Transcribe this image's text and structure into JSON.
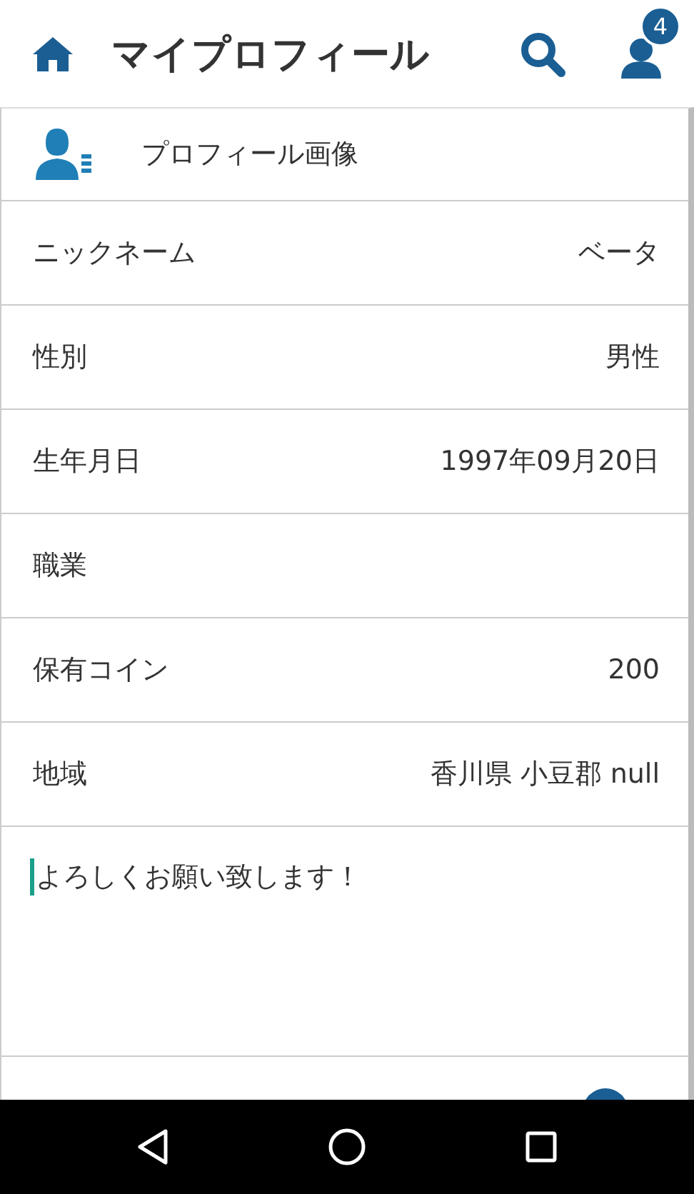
{
  "header": {
    "title": "マイプロフィール",
    "badge": "4"
  },
  "profile_image": {
    "label": "プロフィール画像"
  },
  "fields": [
    {
      "label": "ニックネーム",
      "value": "ベータ"
    },
    {
      "label": "性別",
      "value": "男性"
    },
    {
      "label": "生年月日",
      "value": "1997年09月20日"
    },
    {
      "label": "職業"
    },
    {
      "label": "保有コイン",
      "value": "200"
    },
    {
      "label": "地域",
      "value": "香川県 小豆郡 null"
    }
  ],
  "bio": {
    "value": "よろしくお願い致します！",
    "focused": true
  }
}
